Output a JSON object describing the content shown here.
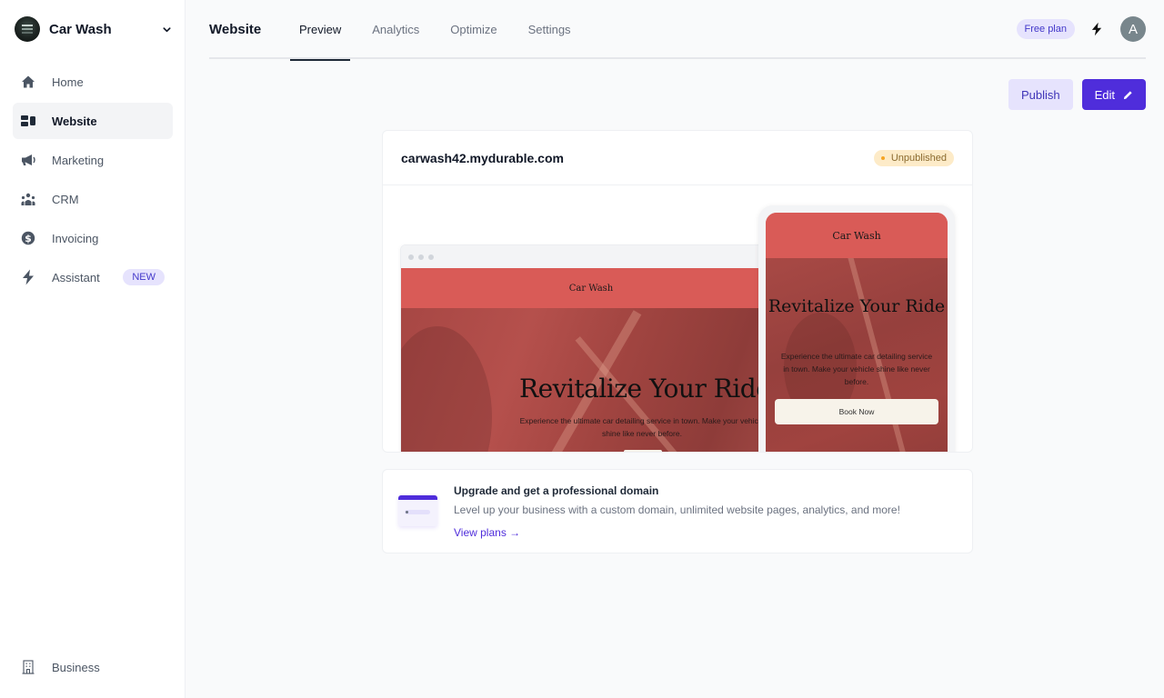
{
  "sidebar": {
    "business_name": "Car Wash",
    "items": [
      {
        "label": "Home",
        "icon": "home-icon",
        "active": false
      },
      {
        "label": "Website",
        "icon": "website-icon",
        "active": true
      },
      {
        "label": "Marketing",
        "icon": "megaphone-icon",
        "active": false
      },
      {
        "label": "CRM",
        "icon": "people-icon",
        "active": false
      },
      {
        "label": "Invoicing",
        "icon": "dollar-circle-icon",
        "active": false
      },
      {
        "label": "Assistant",
        "icon": "bolt-icon",
        "active": false,
        "badge": "NEW"
      }
    ],
    "bottom_item": {
      "label": "Business",
      "icon": "building-icon"
    }
  },
  "header": {
    "title": "Website",
    "tabs": [
      {
        "label": "Preview",
        "active": true
      },
      {
        "label": "Analytics",
        "active": false
      },
      {
        "label": "Optimize",
        "active": false
      },
      {
        "label": "Settings",
        "active": false
      }
    ],
    "plan_badge": "Free plan",
    "avatar_initial": "A"
  },
  "actions": {
    "publish_label": "Publish",
    "edit_label": "Edit"
  },
  "preview": {
    "domain": "carwash42.mydurable.com",
    "status": "Unpublished",
    "site": {
      "name": "Car Wash",
      "hero_title": "Revitalize Your Ride",
      "hero_text": "Experience the ultimate car detailing service in town. Make your vehicle shine like never before.",
      "cta_label": "Book Now"
    }
  },
  "upgrade": {
    "title": "Upgrade and get a professional domain",
    "text": "Level up your business with a custom domain, unlimited website pages, analytics, and more!",
    "link_label": "View plans →"
  },
  "colors": {
    "accent": "#4f2ddb",
    "accent_soft": "#e6e3fd",
    "site_primary": "#d95b57",
    "status_warning_bg": "#fdebc8"
  }
}
